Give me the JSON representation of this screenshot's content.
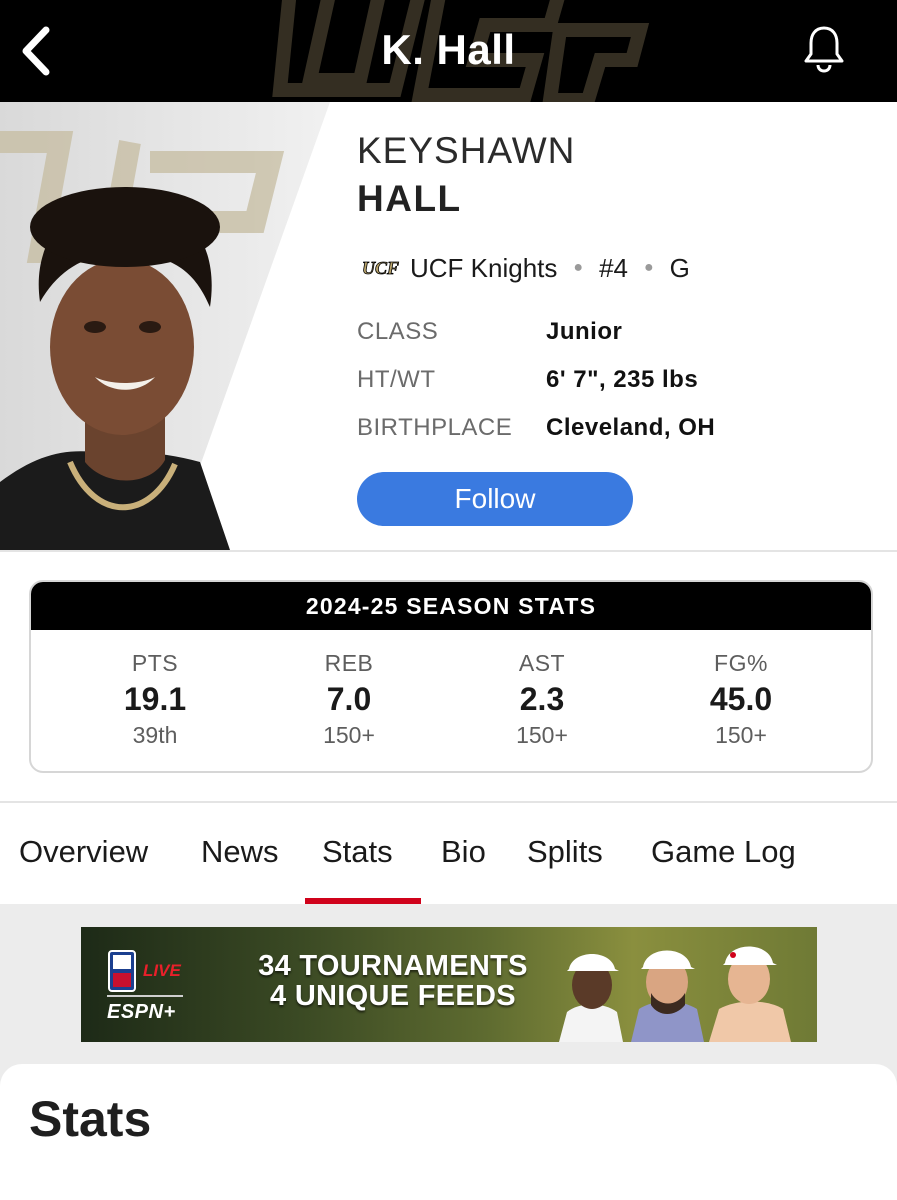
{
  "header": {
    "title": "K. Hall",
    "back_icon": "chevron-left-icon",
    "bell_icon": "bell-icon"
  },
  "player": {
    "first_name": "KEYSHAWN",
    "last_name": "HALL",
    "team": "UCF Knights",
    "number": "#4",
    "position": "G",
    "info": [
      {
        "label": "CLASS",
        "value": "Junior"
      },
      {
        "label": "HT/WT",
        "value": "6' 7\", 235 lbs"
      },
      {
        "label": "BIRTHPLACE",
        "value": "Cleveland, OH"
      }
    ],
    "follow_label": "Follow"
  },
  "season_stats": {
    "title": "2024-25 SEASON STATS",
    "items": [
      {
        "label": "PTS",
        "value": "19.1",
        "rank": "39th"
      },
      {
        "label": "REB",
        "value": "7.0",
        "rank": "150+"
      },
      {
        "label": "AST",
        "value": "2.3",
        "rank": "150+"
      },
      {
        "label": "FG%",
        "value": "45.0",
        "rank": "150+"
      }
    ]
  },
  "tabs": [
    "Overview",
    "News",
    "Stats",
    "Bio",
    "Splits",
    "Game Log"
  ],
  "active_tab": "Stats",
  "ad": {
    "live": "LIVE",
    "brand": "ESPN+",
    "line1": "34 TOURNAMENTS",
    "line2": "4 UNIQUE FEEDS"
  },
  "section": {
    "title": "Stats"
  },
  "colors": {
    "header_bg": "#000000",
    "follow_blue": "#3a7ae0",
    "tab_active_underline": "#d0021b",
    "content_bg": "#ececec"
  }
}
